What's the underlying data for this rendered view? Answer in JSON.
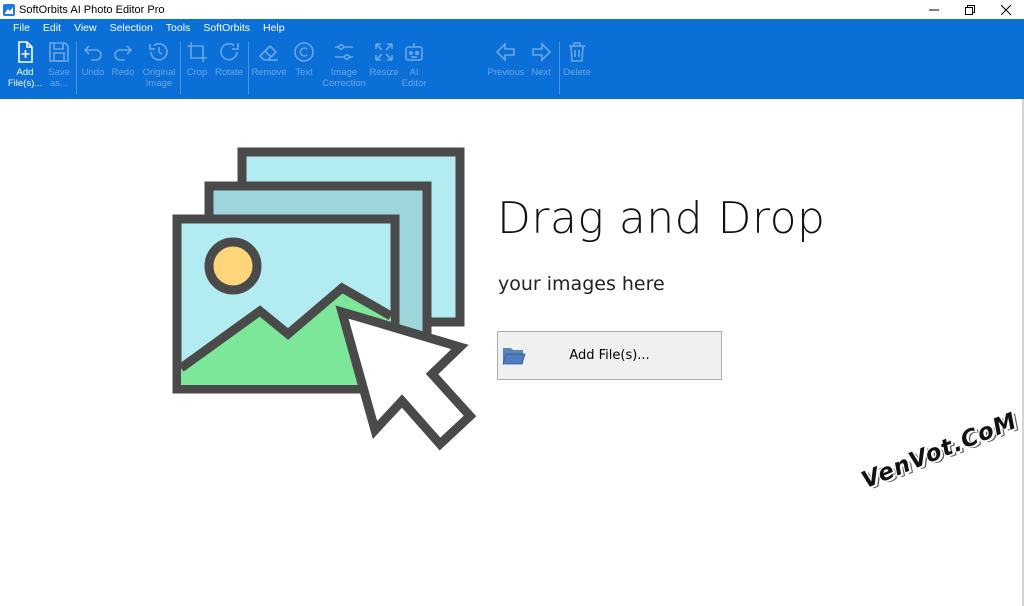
{
  "window": {
    "title": "SoftOrbits AI Photo Editor Pro",
    "minimize": "—",
    "restore": "❐",
    "close": "✕"
  },
  "menu": [
    {
      "label": "File"
    },
    {
      "label": "Edit"
    },
    {
      "label": "View"
    },
    {
      "label": "Selection"
    },
    {
      "label": "Tools"
    },
    {
      "label": "SoftOrbits"
    },
    {
      "label": "Help"
    }
  ],
  "toolbar": {
    "add_files": "Add\nFile(s)...",
    "save_as": "Save\nas...",
    "undo": "Undo",
    "redo": "Redo",
    "original_image": "Original\nImage",
    "crop": "Crop",
    "rotate": "Rotate",
    "remove": "Remove",
    "text": "Text",
    "image_correction": "Image\nCorrection",
    "resize": "Resize",
    "ai_editor": "AI\nEditor",
    "previous": "Previous",
    "next": "Next",
    "delete": "Delete"
  },
  "main": {
    "title": "Drag and Drop",
    "subtitle": "your images here",
    "add_button": "Add File(s)..."
  },
  "watermark": "VenVot.CoM",
  "colors": {
    "ribbon": "#0a6fd6",
    "icon_active": "#ffffff",
    "icon_disabled": "#6fa6e4",
    "frame": "#4a4a4a",
    "photo_sky": "#b2ecf0",
    "photo_back": "#9fd6dc",
    "hill": "#7ce699",
    "sun": "#fdd67a"
  }
}
